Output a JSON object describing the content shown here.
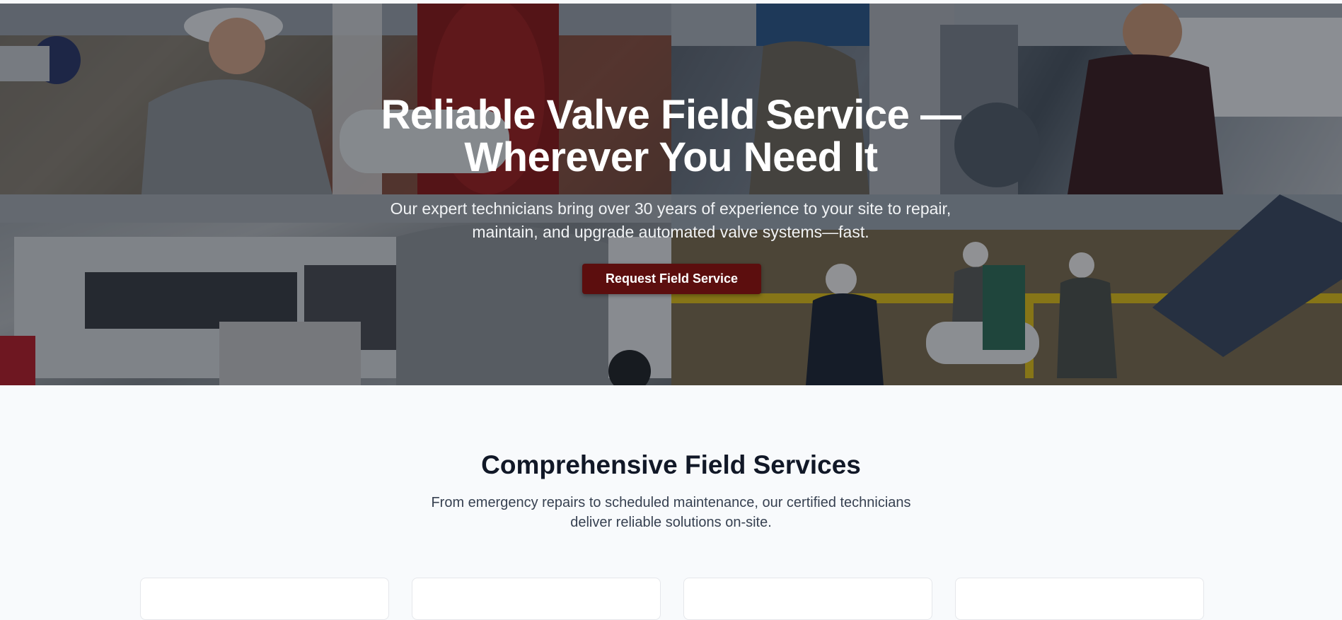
{
  "hero": {
    "title_line1": "Reliable Valve Field Service —",
    "title_line2": "Wherever You Need It",
    "subtitle_line1": "Our expert technicians bring over 30 years of experience to your site to repair,",
    "subtitle_line2": "maintain, and upgrade automated valve systems—fast.",
    "cta_label": "Request Field Service",
    "cta_color": "#5c0e0e"
  },
  "services": {
    "title": "Comprehensive Field Services",
    "subtitle_line1": "From emergency repairs to scheduled maintenance, our certified technicians",
    "subtitle_line2": "deliver reliable solutions on-site."
  }
}
